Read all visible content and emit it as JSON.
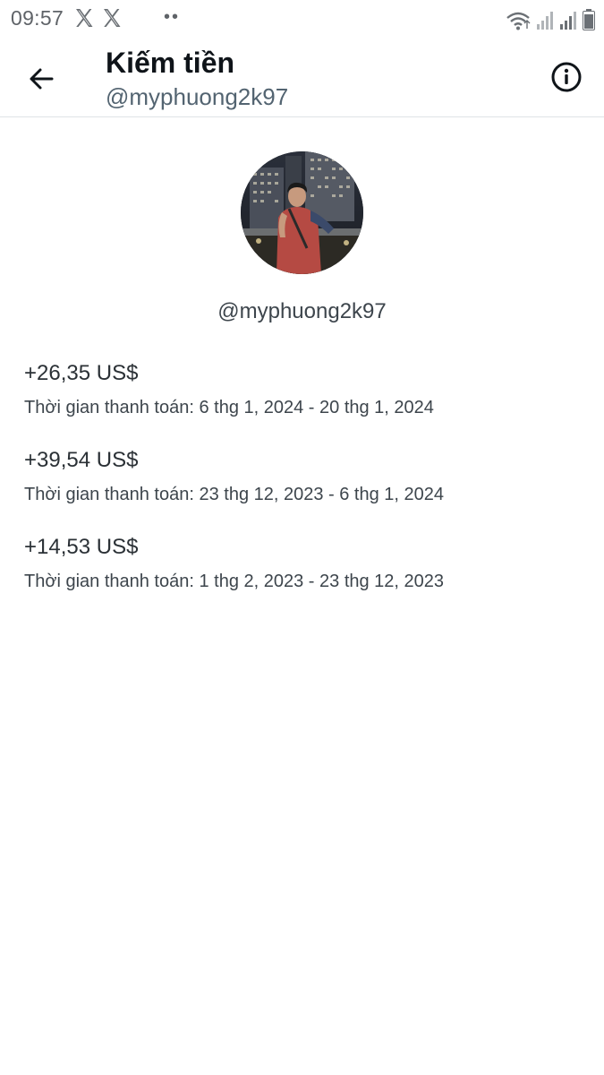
{
  "status_bar": {
    "time": "09:57",
    "notification_icons": [
      "x-logo-icon",
      "x-logo-icon"
    ],
    "more_indicator": "••",
    "system_icons": [
      "wifi-icon",
      "signal-icon",
      "signal-icon",
      "battery-icon"
    ]
  },
  "header": {
    "back_icon": "arrow-left-icon",
    "title": "Kiếm tiền",
    "subtitle": "@myphuong2k97",
    "info_icon": "info-circle-icon"
  },
  "profile": {
    "handle": "@myphuong2k97"
  },
  "payouts": [
    {
      "amount": "+26,35 US$",
      "period": "Thời gian thanh toán: 6 thg 1, 2024 - 20 thg 1, 2024"
    },
    {
      "amount": "+39,54 US$",
      "period": "Thời gian thanh toán: 23 thg 12, 2023 - 6 thg 1, 2024"
    },
    {
      "amount": "+14,53 US$",
      "period": "Thời gian thanh toán: 1 thg 2, 2023 - 23 thg 12, 2023"
    }
  ],
  "colors": {
    "text_primary": "#0f1419",
    "text_secondary": "#536471",
    "divider": "#dfe3e6"
  }
}
